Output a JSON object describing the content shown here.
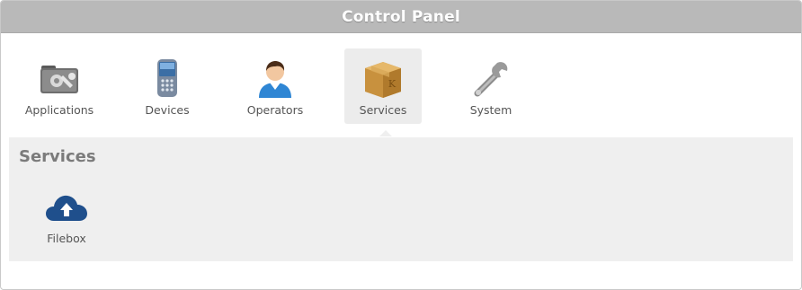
{
  "window": {
    "title": "Control Panel"
  },
  "toolbar": {
    "items": [
      {
        "label": "Applications",
        "icon": "applications-icon"
      },
      {
        "label": "Devices",
        "icon": "devices-icon"
      },
      {
        "label": "Operators",
        "icon": "operators-icon"
      },
      {
        "label": "Services",
        "icon": "services-icon",
        "active": true
      },
      {
        "label": "System",
        "icon": "system-icon"
      }
    ]
  },
  "panel": {
    "title": "Services",
    "items": [
      {
        "label": "Filebox",
        "icon": "cloud-upload-icon"
      }
    ]
  },
  "colors": {
    "titlebar": "#b9b9b9",
    "panel_bg": "#efefef",
    "active_tab_bg": "#ececec",
    "text": "#555555"
  }
}
